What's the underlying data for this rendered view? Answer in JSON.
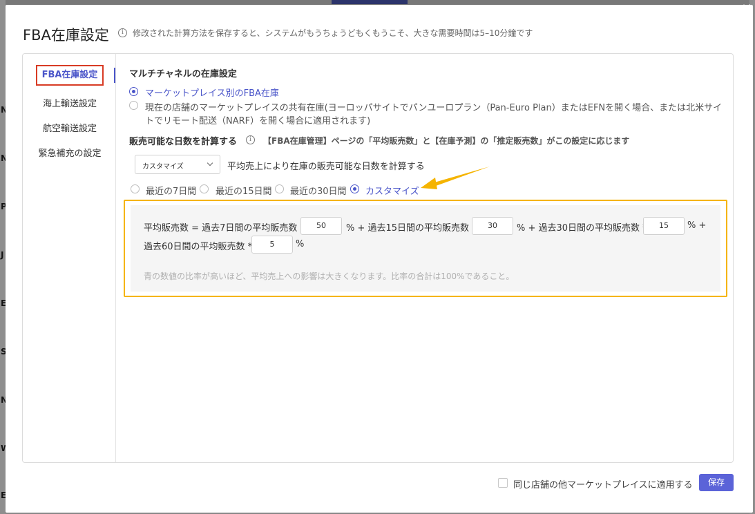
{
  "modal": {
    "title": "FBA在庫設定",
    "description": "修改された計算方法を保存すると、システムがもうちょうどもくもうこそ、大きな需要時間は5–10分鐘です",
    "close_label": "✕"
  },
  "sidebar": {
    "items": [
      {
        "label": "FBA在庫設定",
        "active": true
      },
      {
        "label": "海上輸送設定"
      },
      {
        "label": "航空輸送設定"
      },
      {
        "label": "緊急補充の設定"
      }
    ]
  },
  "multichannel": {
    "title": "マルチチャネルの在庫設定",
    "options": [
      {
        "label": "マーケットプレイス別のFBA在庫",
        "selected": true
      },
      {
        "label_line1": "現在の店舗のマーケットプレイスの共有在庫(ヨーロッパサイトでパンユーロプラン（Pan-Euro Plan）またはEFNを開く場合、または北米サイ",
        "label_line2": "トでリモート配送（NARF）を開く場合に適用されます)",
        "selected": false
      }
    ]
  },
  "sellable_days": {
    "title": "販売可能な日数を計算する",
    "note": "【FBA在庫管理】ページの「平均販売数」と【在庫予測】の「推定販売数」がこの設定に応じます",
    "select_value": "カスタマイズ",
    "select_desc": "平均売上により在庫の販売可能な日数を計算する",
    "periods": [
      {
        "label": "最近の7日間",
        "selected": false
      },
      {
        "label": "最近の15日間",
        "selected": false
      },
      {
        "label": "最近の30日間",
        "selected": false
      },
      {
        "label": "カスタマイズ",
        "selected": true
      }
    ]
  },
  "formula": {
    "part1": "平均販売数 = 過去7日間の平均販売数 *",
    "value1": "50",
    "part2": "% + 過去15日間の平均販売数 *",
    "value2": "30",
    "part3": "% + 過去30日間の平均販売数 *",
    "value3": "15",
    "part4": "% +",
    "part5": "過去60日間の平均販売数 *",
    "value4": "5",
    "part6": "%",
    "hint": "青の数値の比率が高いほど、平均売上への影響は大きくなります。比率の合計は100%であること。"
  },
  "footer": {
    "apply_label": "同じ店舗の他マーケットプレイスに適用する",
    "save_label": "保存"
  },
  "background": {
    "left_letters": [
      "N",
      "N",
      "P",
      "J",
      "E",
      "S",
      "N",
      "W",
      "E"
    ]
  },
  "colors": {
    "accent": "#4a55c9",
    "highlight_box": "#f5b400",
    "active_tab_border": "#d83b24",
    "save_button": "#5b63d8"
  }
}
